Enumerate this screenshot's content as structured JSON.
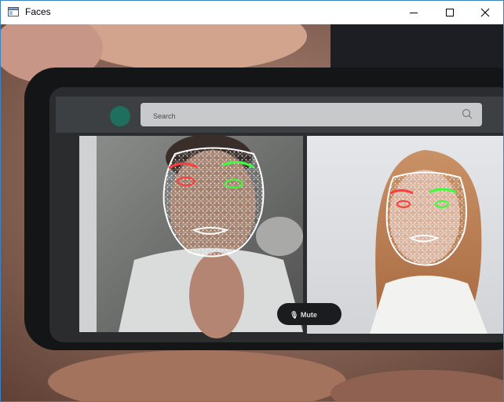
{
  "window": {
    "title": "Faces",
    "controls": {
      "minimize": "minimize",
      "maximize": "maximize",
      "close": "close"
    }
  },
  "phone_screen": {
    "search": {
      "text": "Search"
    },
    "call_control_label": "🎙 Mute"
  },
  "overlay": {
    "mesh_color": "#ffffff",
    "left_eye_brow_color": "#ff3b3b",
    "right_eye_brow_color": "#3bff3b",
    "faces_detected": 2
  },
  "icons": [
    "app-window-icon",
    "minimize-icon",
    "maximize-icon",
    "close-icon",
    "search-icon"
  ]
}
